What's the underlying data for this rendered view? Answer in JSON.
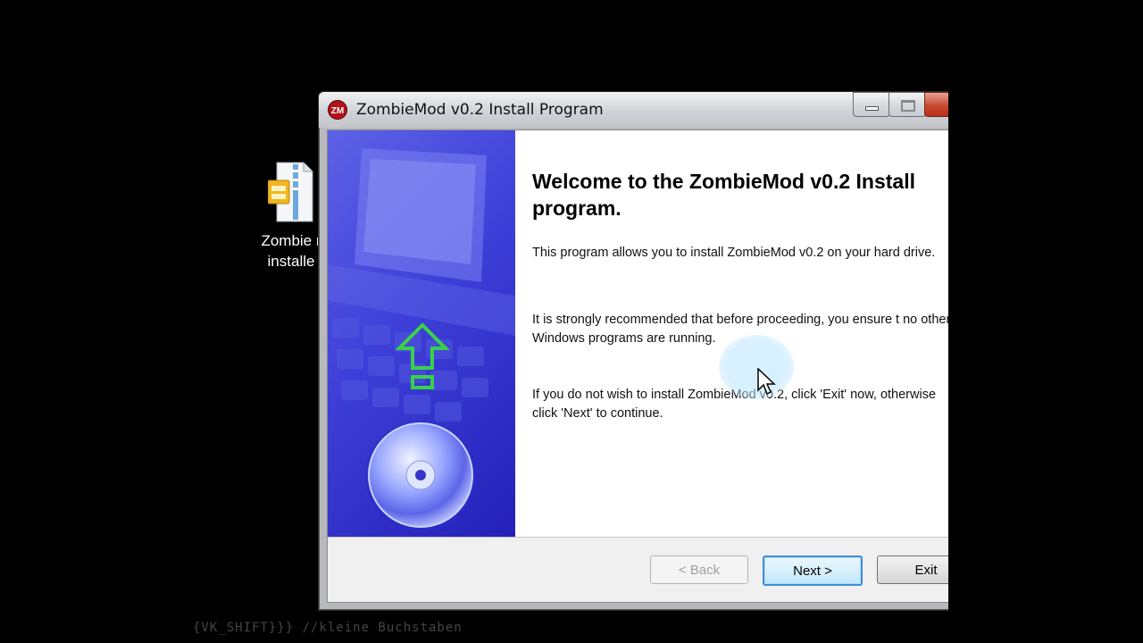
{
  "desktop": {
    "icon_label_line1": "Zombie r",
    "icon_label_line2": "installe",
    "icon": "zip-archive-icon"
  },
  "window": {
    "title": "ZombieMod v0.2 Install Program",
    "app_icon_text": "ZM",
    "heading": "Welcome to the ZombieMod v0.2 Install program.",
    "paragraph1": "This program allows you to install ZombieMod v0.2 on your hard drive.",
    "paragraph2": "It is strongly recommended that before proceeding, you ensure t no other Windows programs are running.",
    "paragraph3": "If you do not wish to install ZombieMod v0.2, click 'Exit' now, otherwise click 'Next' to continue.",
    "buttons": {
      "back": "< Back",
      "next": "Next >",
      "exit": "Exit"
    }
  },
  "overlay_text": "{VK_SHIFT}}} //kleine Buchstaben",
  "colors": {
    "side_panel": "#3e3fd8",
    "arrow": "#39d14a",
    "accent": "#3c8fd9"
  }
}
